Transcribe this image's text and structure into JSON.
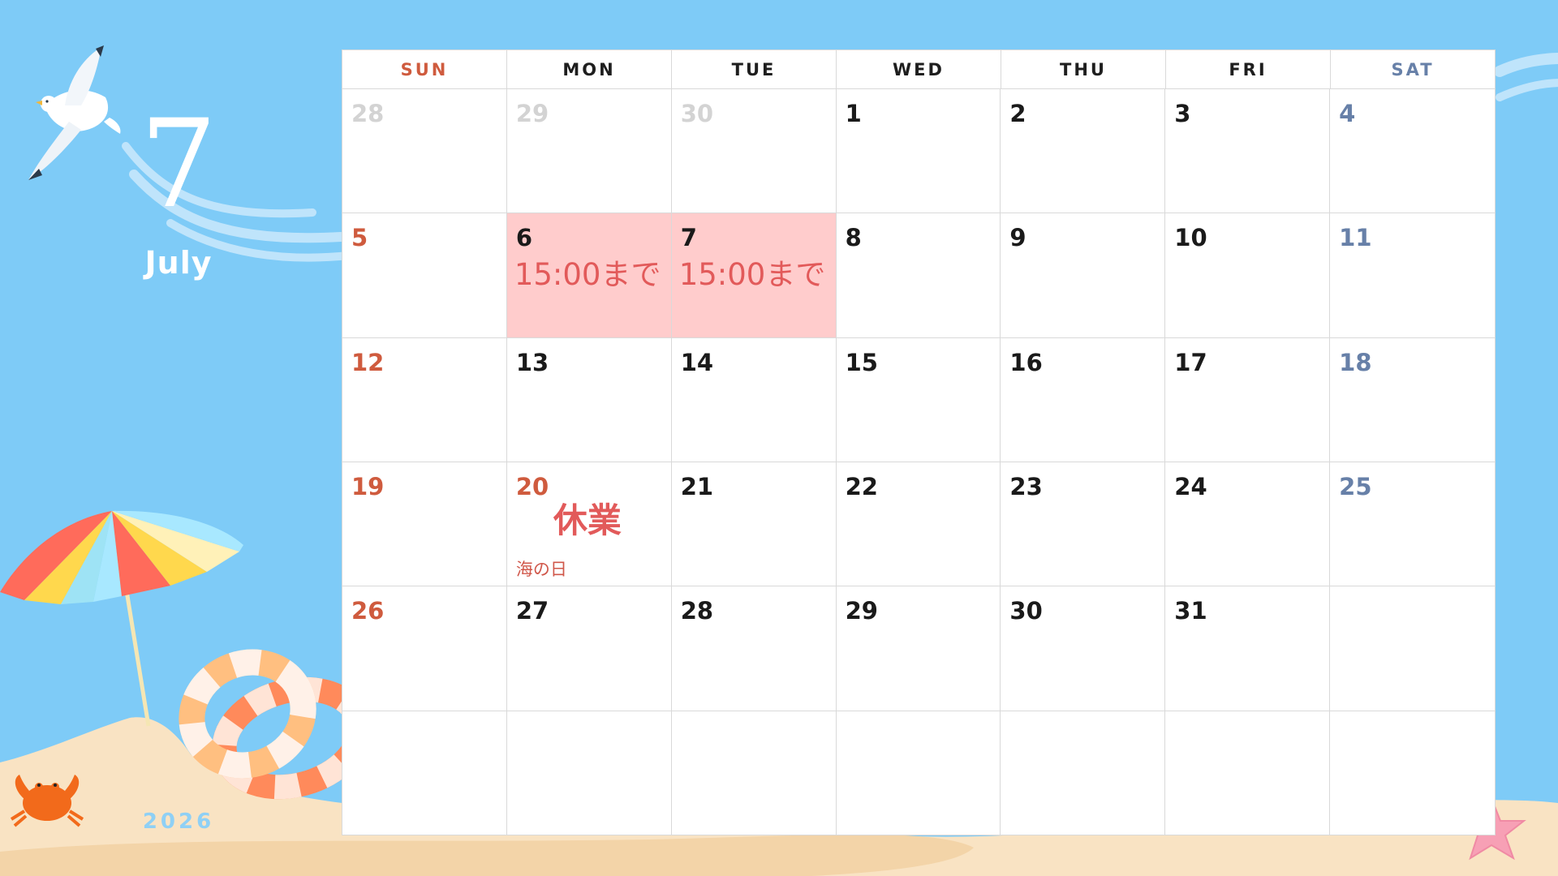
{
  "month": {
    "number": "7",
    "name": "July",
    "year": "2026"
  },
  "weekdays": [
    "SUN",
    "MON",
    "TUE",
    "WED",
    "THU",
    "FRI",
    "SAT"
  ],
  "colors": {
    "sun": "#cf5b3e",
    "sat": "#6780a8",
    "highlight": "#ffcccc",
    "note": "#e25a5a",
    "background": "#7ecbf7"
  },
  "weeks": [
    [
      {
        "date": "28",
        "muted": true
      },
      {
        "date": "29",
        "muted": true
      },
      {
        "date": "30",
        "muted": true
      },
      {
        "date": "1"
      },
      {
        "date": "2"
      },
      {
        "date": "3"
      },
      {
        "date": "4"
      }
    ],
    [
      {
        "date": "5"
      },
      {
        "date": "6",
        "highlight": true,
        "note": "15:00まで"
      },
      {
        "date": "7",
        "highlight": true,
        "note": "15:00まで"
      },
      {
        "date": "8"
      },
      {
        "date": "9"
      },
      {
        "date": "10"
      },
      {
        "date": "11"
      }
    ],
    [
      {
        "date": "12"
      },
      {
        "date": "13"
      },
      {
        "date": "14"
      },
      {
        "date": "15"
      },
      {
        "date": "16"
      },
      {
        "date": "17"
      },
      {
        "date": "18"
      }
    ],
    [
      {
        "date": "19"
      },
      {
        "date": "20",
        "note": "休業",
        "note_big": true,
        "holiday": "海の日"
      },
      {
        "date": "21"
      },
      {
        "date": "22"
      },
      {
        "date": "23"
      },
      {
        "date": "24"
      },
      {
        "date": "25"
      }
    ],
    [
      {
        "date": "26"
      },
      {
        "date": "27"
      },
      {
        "date": "28"
      },
      {
        "date": "29"
      },
      {
        "date": "30"
      },
      {
        "date": "31"
      },
      {
        "date": ""
      }
    ],
    [
      {
        "date": ""
      },
      {
        "date": ""
      },
      {
        "date": ""
      },
      {
        "date": ""
      },
      {
        "date": ""
      },
      {
        "date": ""
      },
      {
        "date": ""
      }
    ]
  ]
}
